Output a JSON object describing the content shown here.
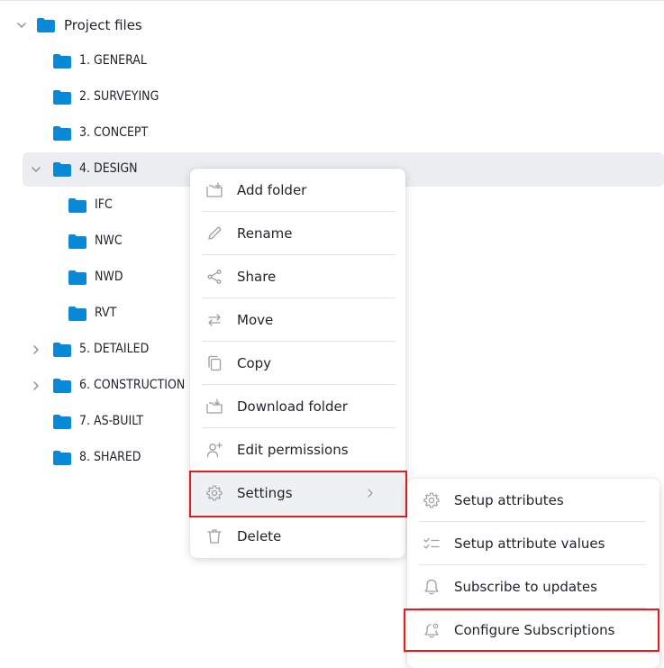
{
  "tree": {
    "root": {
      "label": "Project files",
      "expanded": true
    },
    "items": [
      {
        "label": "1. GENERAL"
      },
      {
        "label": "2. SURVEYING"
      },
      {
        "label": "3. CONCEPT"
      },
      {
        "label": "4. DESIGN",
        "expanded": true,
        "selected": true
      },
      {
        "label": "IFC"
      },
      {
        "label": "NWC"
      },
      {
        "label": "NWD"
      },
      {
        "label": "RVT"
      },
      {
        "label": "5. DETAILED",
        "expanded": false
      },
      {
        "label": "6. CONSTRUCTION",
        "expanded": false
      },
      {
        "label": "7. AS-BUILT"
      },
      {
        "label": "8. SHARED"
      }
    ]
  },
  "context_menu": {
    "items": [
      {
        "label": "Add folder",
        "icon": "add-folder-icon"
      },
      {
        "label": "Rename",
        "icon": "pencil-icon"
      },
      {
        "label": "Share",
        "icon": "share-icon"
      },
      {
        "label": "Move",
        "icon": "move-arrows-icon"
      },
      {
        "label": "Copy",
        "icon": "copy-icon"
      },
      {
        "label": "Download folder",
        "icon": "download-folder-icon"
      },
      {
        "label": "Edit permissions",
        "icon": "user-plus-icon"
      },
      {
        "label": "Settings",
        "icon": "gear-icon",
        "has_submenu": true,
        "active": true
      },
      {
        "label": "Delete",
        "icon": "trash-icon"
      }
    ]
  },
  "settings_submenu": {
    "items": [
      {
        "label": "Setup attributes",
        "icon": "gear-icon"
      },
      {
        "label": "Setup attribute values",
        "icon": "checklist-icon"
      },
      {
        "label": "Subscribe to updates",
        "icon": "bell-icon"
      },
      {
        "label": "Configure Subscriptions",
        "icon": "bell-gear-icon",
        "highlighted": true
      }
    ]
  },
  "colors": {
    "folder": "#0a8ad6",
    "highlight_border": "#e01e1e",
    "selected_row": "#ebedf0",
    "icon_gray": "#9aa0a6"
  }
}
